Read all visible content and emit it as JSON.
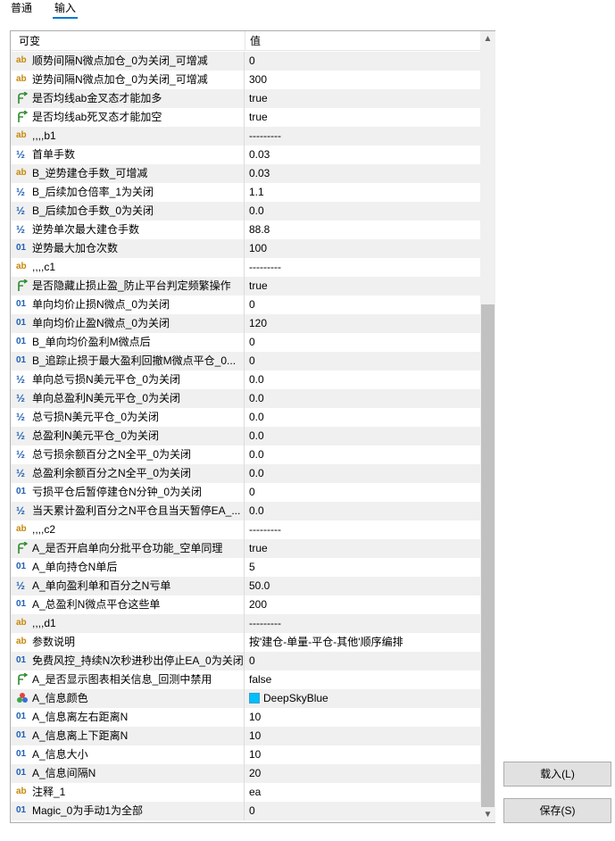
{
  "tabs": [
    {
      "label": "普通"
    },
    {
      "label": "输入"
    }
  ],
  "grid": {
    "col_variable": "可变",
    "col_value": "值",
    "rows": [
      {
        "type": "ab",
        "name": "顺势间隔N微点加仓_0为关闭_可增减",
        "value": "0"
      },
      {
        "type": "ab",
        "name": "逆势间隔N微点加仓_0为关闭_可增减",
        "value": "300"
      },
      {
        "type": "bool",
        "name": "是否均线ab金叉态才能加多",
        "value": "true"
      },
      {
        "type": "bool",
        "name": "是否均线ab死叉态才能加空",
        "value": "true"
      },
      {
        "type": "ab",
        "name": ",,,,b1",
        "value": "---------"
      },
      {
        "type": "half",
        "name": "首单手数",
        "value": "0.03"
      },
      {
        "type": "ab",
        "name": "B_逆势建仓手数_可增减",
        "value": "0.03"
      },
      {
        "type": "half",
        "name": "B_后续加仓倍率_1为关闭",
        "value": "1.1"
      },
      {
        "type": "half",
        "name": "B_后续加仓手数_0为关闭",
        "value": "0.0"
      },
      {
        "type": "half",
        "name": "逆势单次最大建仓手数",
        "value": "88.8"
      },
      {
        "type": "01",
        "name": "逆势最大加仓次数",
        "value": "100"
      },
      {
        "type": "ab",
        "name": ",,,,c1",
        "value": "---------"
      },
      {
        "type": "bool",
        "name": "是否隐藏止损止盈_防止平台判定频繁操作",
        "value": "true"
      },
      {
        "type": "01",
        "name": "单向均价止损N微点_0为关闭",
        "value": "0"
      },
      {
        "type": "01",
        "name": "单向均价止盈N微点_0为关闭",
        "value": "120"
      },
      {
        "type": "01",
        "name": "B_单向均价盈利M微点后",
        "value": "0"
      },
      {
        "type": "01",
        "name": "B_追踪止损于最大盈利回撤M微点平仓_0...",
        "value": "0"
      },
      {
        "type": "half",
        "name": "单向总亏损N美元平仓_0为关闭",
        "value": "0.0"
      },
      {
        "type": "half",
        "name": "单向总盈利N美元平仓_0为关闭",
        "value": "0.0"
      },
      {
        "type": "half",
        "name": "总亏损N美元平仓_0为关闭",
        "value": "0.0"
      },
      {
        "type": "half",
        "name": "总盈利N美元平仓_0为关闭",
        "value": "0.0"
      },
      {
        "type": "half",
        "name": "总亏损余额百分之N全平_0为关闭",
        "value": "0.0"
      },
      {
        "type": "half",
        "name": "总盈利余额百分之N全平_0为关闭",
        "value": "0.0"
      },
      {
        "type": "01",
        "name": "亏损平仓后暂停建仓N分钟_0为关闭",
        "value": "0"
      },
      {
        "type": "half",
        "name": "当天累计盈利百分之N平仓且当天暂停EA_...",
        "value": "0.0"
      },
      {
        "type": "ab",
        "name": ",,,,c2",
        "value": "---------"
      },
      {
        "type": "bool",
        "name": "A_是否开启单向分批平仓功能_空单同理",
        "value": "true"
      },
      {
        "type": "01",
        "name": "A_单向持仓N单后",
        "value": "5"
      },
      {
        "type": "half",
        "name": "A_单向盈利单和百分之N亏单",
        "value": "50.0"
      },
      {
        "type": "01",
        "name": "A_总盈利N微点平仓这些单",
        "value": "200"
      },
      {
        "type": "ab",
        "name": ",,,,d1",
        "value": "---------"
      },
      {
        "type": "ab",
        "name": "参数说明",
        "value": "按'建仓-单量-平仓-其他'顺序编排"
      },
      {
        "type": "01",
        "name": "免费风控_持续N次秒进秒出停止EA_0为关闭",
        "value": "0"
      },
      {
        "type": "bool",
        "name": "A_是否显示图表相关信息_回测中禁用",
        "value": "false"
      },
      {
        "type": "color",
        "name": "A_信息颜色",
        "value": "DeepSkyBlue",
        "swatch": "#00bfff"
      },
      {
        "type": "01",
        "name": "A_信息离左右距离N",
        "value": "10"
      },
      {
        "type": "01",
        "name": "A_信息离上下距离N",
        "value": "10"
      },
      {
        "type": "01",
        "name": "A_信息大小",
        "value": "10"
      },
      {
        "type": "01",
        "name": "A_信息间隔N",
        "value": "20"
      },
      {
        "type": "ab",
        "name": "注释_1",
        "value": "ea"
      },
      {
        "type": "01",
        "name": "Magic_0为手动1为全部",
        "value": "0"
      }
    ]
  },
  "icons": {
    "ab": "ab",
    "01": "01",
    "half": "½"
  },
  "buttons": {
    "load_label": "载入(L)",
    "save_label": "保存(S)"
  },
  "colors": {
    "accent": "#0078d7",
    "shaded_row": "#f0f0f0",
    "ab_icon": "#c6890a",
    "num_icon": "#1f5fb5",
    "bool_icon": "#2e8b2e"
  }
}
